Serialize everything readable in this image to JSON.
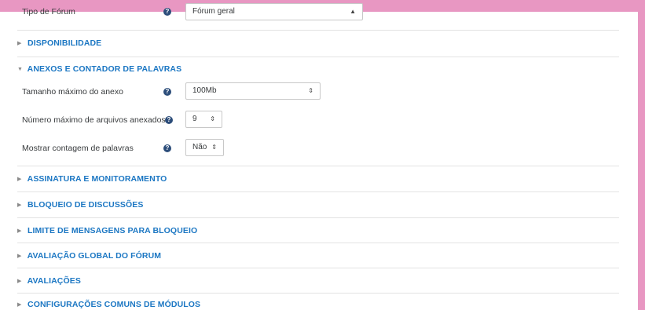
{
  "top_field": {
    "label": "Tipo de Fórum",
    "value": "Fórum geral"
  },
  "sections": {
    "disponibilidade": "DISPONIBILIDADE",
    "anexos": "ANEXOS E CONTADOR DE PALAVRAS",
    "assinatura": "ASSINATURA E MONITORAMENTO",
    "bloqueio": "BLOQUEIO DE DISCUSSÕES",
    "limite": "LIMITE DE MENSAGENS PARA BLOQUEIO",
    "avaliacao_global": "AVALIAÇÃO GLOBAL DO FÓRUM",
    "avaliacoes": "AVALIAÇÕES",
    "configuracoes": "CONFIGURAÇÕES COMUNS DE MÓDULOS"
  },
  "fields": {
    "tamanho": {
      "label": "Tamanho máximo do anexo",
      "value": "100Mb"
    },
    "numero": {
      "label": "Número máximo de arquivos anexados",
      "value": "9"
    },
    "mostrar": {
      "label": "Mostrar contagem de palavras",
      "value": "Não"
    }
  },
  "icons": {
    "help": "question-circle",
    "expand": "triangle-right",
    "collapse": "triangle-down",
    "select": "up-down-caret"
  },
  "colors": {
    "frame": "#e897c2",
    "section": "#1c77c3",
    "help": "#2c4d7a"
  }
}
